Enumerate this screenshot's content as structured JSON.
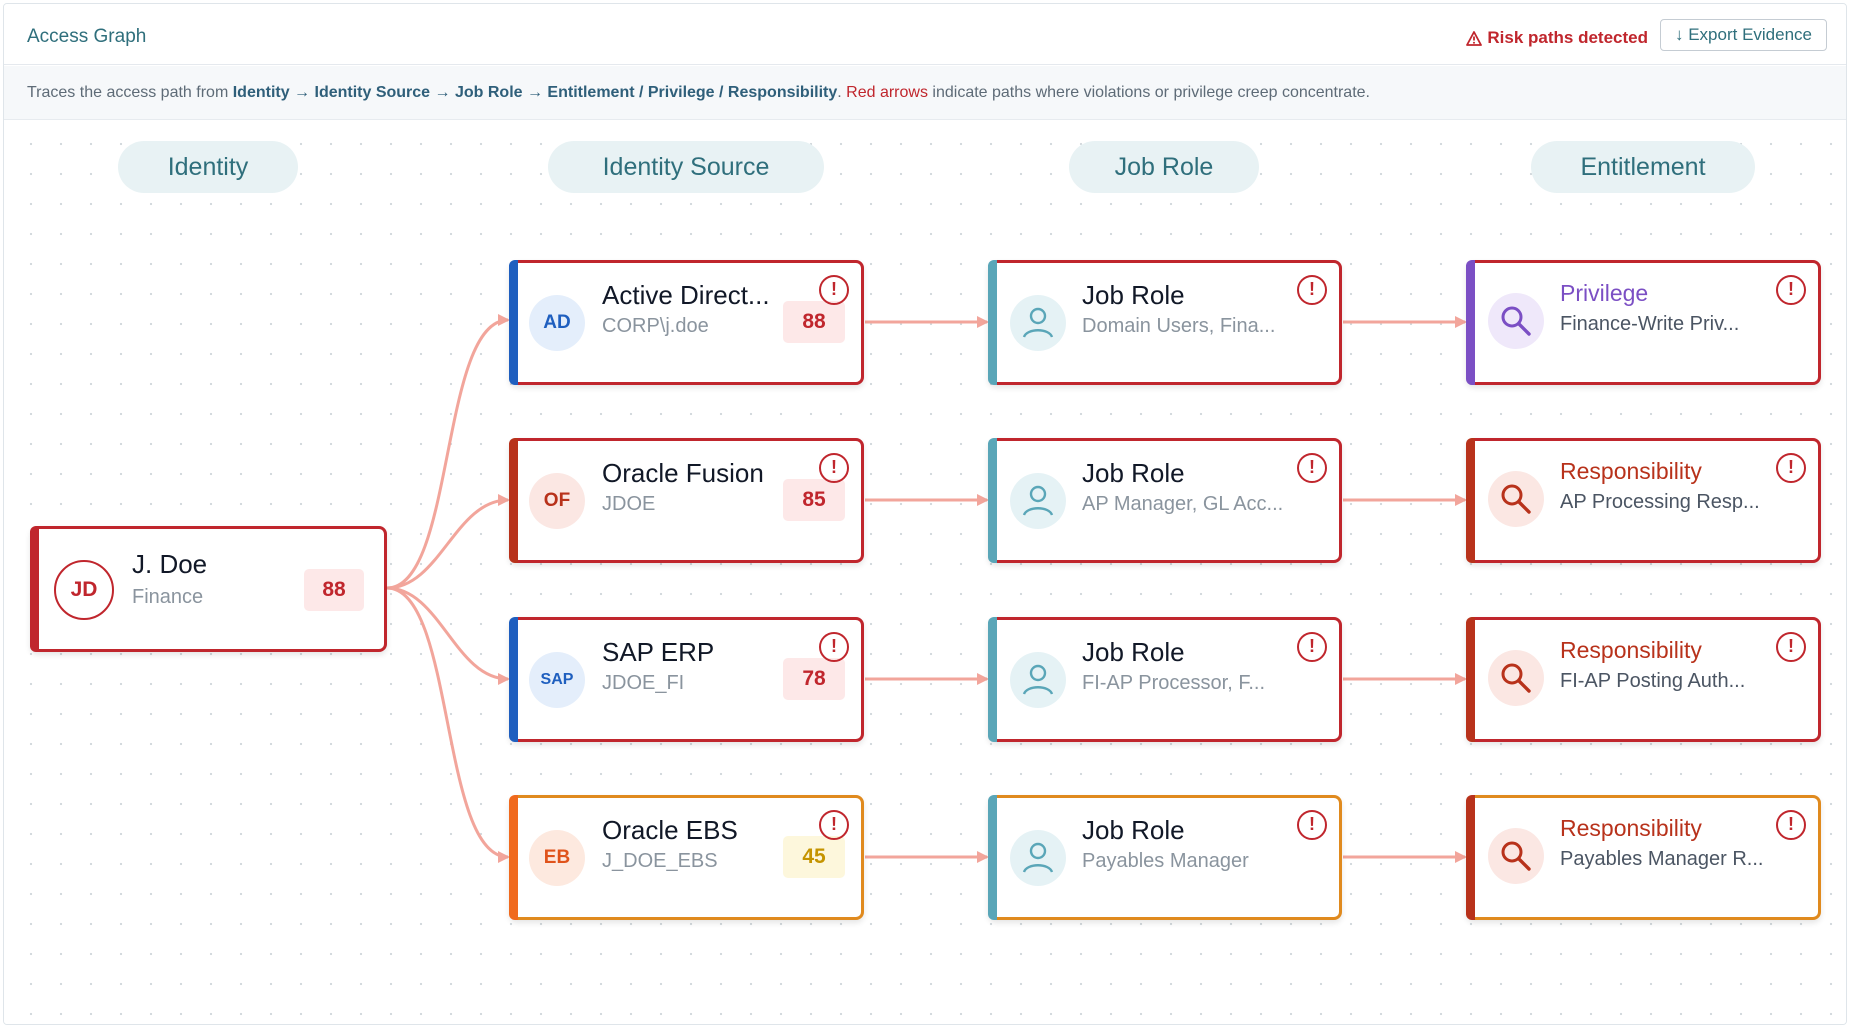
{
  "header": {
    "title": "Access Graph",
    "risk_label": "Risk paths detected",
    "risk_icon": "warning-triangle-icon",
    "export_label": "↓ Export Evidence"
  },
  "subbar": {
    "lead": "Traces the access path from ",
    "path_identity": "Identity",
    "arrow": " → ",
    "path_source": "Identity Source",
    "path_role": "Job Role",
    "path_entitlement": "Entitlement / Privilege / Responsibility",
    "period": ". ",
    "red_text": "Red arrows",
    "tail": " indicate paths where violations or privilege creep concentrate."
  },
  "columns": {
    "identity": "Identity",
    "source": "Identity Source",
    "role": "Job Role",
    "entitlement": "Entitlement"
  },
  "identity": {
    "initials": "JD",
    "name": "J. Doe",
    "department": "Finance",
    "score": "88"
  },
  "sources": [
    {
      "initials": "AD",
      "name": "Active Direct...",
      "account": "CORP\\j.doe",
      "score": "88"
    },
    {
      "initials": "OF",
      "name": "Oracle Fusion",
      "account": "JDOE",
      "score": "85"
    },
    {
      "initials": "SAP",
      "name": "SAP ERP",
      "account": "JDOE_FI",
      "score": "78"
    },
    {
      "initials": "EB",
      "name": "Oracle EBS",
      "account": "J_DOE_EBS",
      "score": "45"
    }
  ],
  "roles": [
    {
      "name": "Job Role",
      "detail": "Domain Users, Fina..."
    },
    {
      "name": "Job Role",
      "detail": "AP Manager, GL Acc..."
    },
    {
      "name": "Job Role",
      "detail": "FI-AP Processor, F..."
    },
    {
      "name": "Job Role",
      "detail": "Payables Manager"
    }
  ],
  "entitlements": [
    {
      "type": "Privilege",
      "detail": "Finance-Write Priv..."
    },
    {
      "type": "Responsibility",
      "detail": "AP Processing Resp..."
    },
    {
      "type": "Responsibility",
      "detail": "FI-AP Posting Auth..."
    },
    {
      "type": "Responsibility",
      "detail": "Payables Manager R..."
    }
  ],
  "alert_symbol": "!",
  "colors": {
    "risk_red": "#c0262d",
    "warn_orange": "#e08a1e",
    "edge": "#f2a59b",
    "teal": "#2f6f7c",
    "ad_blue": "#1f5fbf",
    "of_red": "#b8321b",
    "sap_blue": "#1f5fbf",
    "ebs_orange": "#f06a1e",
    "role_teal": "#5aa6b8",
    "privilege_purple": "#7b4fc4",
    "responsibility_red": "#b8321b"
  }
}
